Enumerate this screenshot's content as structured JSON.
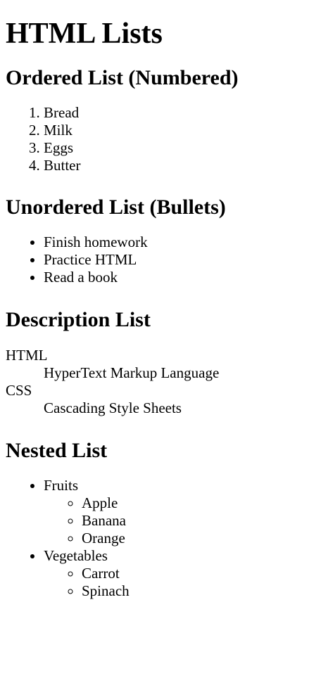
{
  "title": "HTML Lists",
  "ordered": {
    "heading": "Ordered List (Numbered)",
    "items": [
      "Bread",
      "Milk",
      "Eggs",
      "Butter"
    ]
  },
  "unordered": {
    "heading": "Unordered List (Bullets)",
    "items": [
      "Finish homework",
      "Practice HTML",
      "Read a book"
    ]
  },
  "description": {
    "heading": "Description List",
    "entries": [
      {
        "term": "HTML",
        "definition": "HyperText Markup Language"
      },
      {
        "term": "CSS",
        "definition": "Cascading Style Sheets"
      }
    ]
  },
  "nested": {
    "heading": "Nested List",
    "groups": [
      {
        "label": "Fruits",
        "items": [
          "Apple",
          "Banana",
          "Orange"
        ]
      },
      {
        "label": "Vegetables",
        "items": [
          "Carrot",
          "Spinach"
        ]
      }
    ]
  }
}
